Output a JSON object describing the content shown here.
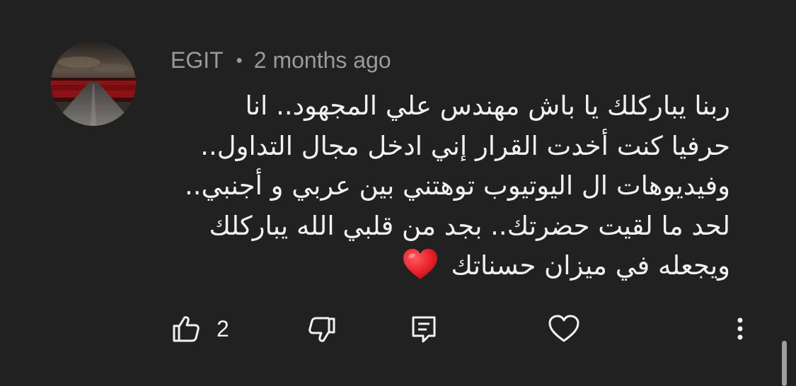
{
  "comment": {
    "author": "EGIT",
    "separator": "•",
    "timestamp": "2 months ago",
    "lines": [
      "ربنا يباركلك يا باش مهندس علي المجهود.. انا",
      "حرفيا كنت أخدت القرار إني ادخل مجال التداول..",
      "وفيديوهات ال اليوتيوب توهتني بين عربي و أجنبي..",
      "لحد ما لقيت حضرتك.. بجد من قلبي الله يباركلك",
      "ويجعله في ميزان حسناتك"
    ],
    "emoji": "red-heart-emoji"
  },
  "actions": {
    "like_icon": "thumbs-up-icon",
    "like_count": "2",
    "dislike_icon": "thumbs-down-icon",
    "reply_icon": "reply-comment-icon",
    "heart_icon": "heart-outline-icon",
    "menu_icon": "more-vertical-icon"
  },
  "colors": {
    "background": "#212121",
    "text": "#f1f1f1",
    "meta_text": "#9a9a9a",
    "emoji_heart": "#e8202a"
  }
}
